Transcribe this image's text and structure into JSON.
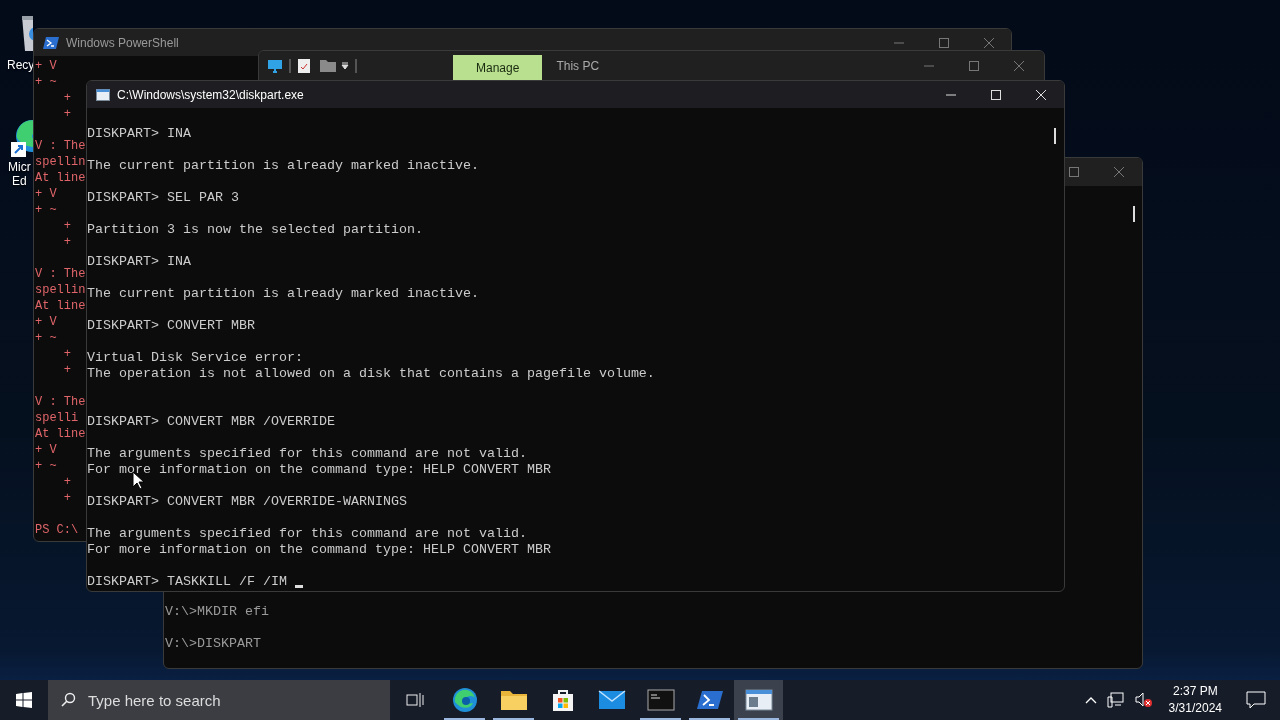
{
  "desktop_icons": [
    {
      "kind": "recycle-bin",
      "label_lines": [
        "Recy"
      ]
    },
    {
      "kind": "edge",
      "label_lines": [
        "Micr",
        "Ed"
      ]
    }
  ],
  "powershell_window": {
    "title": "Windows PowerShell",
    "blocks": [
      {
        "lines": [
          "+ V",
          "+ ~",
          "    +",
          "    +"
        ]
      },
      {
        "lines": [
          "V : The",
          "spellin",
          "At line",
          "+ V",
          "+ ~",
          "    +",
          "    +"
        ]
      },
      {
        "lines": [
          "V : The",
          "spellin",
          "At line",
          "+ V",
          "+ ~",
          "    +",
          "    +"
        ]
      },
      {
        "lines": [
          "V : The",
          "spelli",
          "At line",
          "+ V",
          "+ ~",
          "    +",
          "    +"
        ]
      },
      {
        "lines": [
          "PS C:\\"
        ]
      }
    ]
  },
  "explorer_window": {
    "ribbon_tab": "Manage",
    "title": "This PC"
  },
  "cmd_window": {
    "blocks": [
      {
        "lines": [
          "V:\\>MKDIR efi"
        ]
      },
      {
        "lines": [
          "V:\\>DISKPART"
        ]
      }
    ]
  },
  "diskpart_window": {
    "title": "C:\\Windows\\system32\\diskpart.exe",
    "blocks": [
      {
        "lines": [
          "DISKPART> INA"
        ]
      },
      {
        "lines": [
          "The current partition is already marked inactive."
        ]
      },
      {
        "lines": [
          "DISKPART> SEL PAR 3"
        ]
      },
      {
        "lines": [
          "Partition 3 is now the selected partition."
        ]
      },
      {
        "lines": [
          "DISKPART> INA"
        ]
      },
      {
        "lines": [
          "The current partition is already marked inactive."
        ]
      },
      {
        "lines": [
          "DISKPART> CONVERT MBR"
        ]
      },
      {
        "lines": [
          "Virtual Disk Service error:",
          "The operation is not allowed on a disk that contains a pagefile volume."
        ],
        "extra_gap": true
      },
      {
        "lines": [
          "DISKPART> CONVERT MBR /OVERRIDE"
        ]
      },
      {
        "lines": [
          "The arguments specified for this command are not valid.",
          "For more information on the command type: HELP CONVERT MBR"
        ]
      },
      {
        "lines": [
          "DISKPART> CONVERT MBR /OVERRIDE-WARNINGS"
        ]
      },
      {
        "lines": [
          "The arguments specified for this command are not valid.",
          "For more information on the command type: HELP CONVERT MBR"
        ]
      },
      {
        "lines": [
          "DISKPART> TASKKILL /F /IM"
        ]
      }
    ]
  },
  "taskbar": {
    "search": {
      "placeholder": "Type here to search"
    },
    "apps": [
      {
        "kind": "edge",
        "running": true,
        "selected": false
      },
      {
        "kind": "folder",
        "running": true,
        "selected": false
      },
      {
        "kind": "store",
        "running": false,
        "selected": false
      },
      {
        "kind": "mail",
        "running": false,
        "selected": false
      },
      {
        "kind": "terminal",
        "running": true,
        "selected": false
      },
      {
        "kind": "powershell",
        "running": true,
        "selected": false
      },
      {
        "kind": "app-window",
        "running": true,
        "selected": true
      }
    ],
    "time": "2:37 PM",
    "date": "3/31/2024"
  }
}
